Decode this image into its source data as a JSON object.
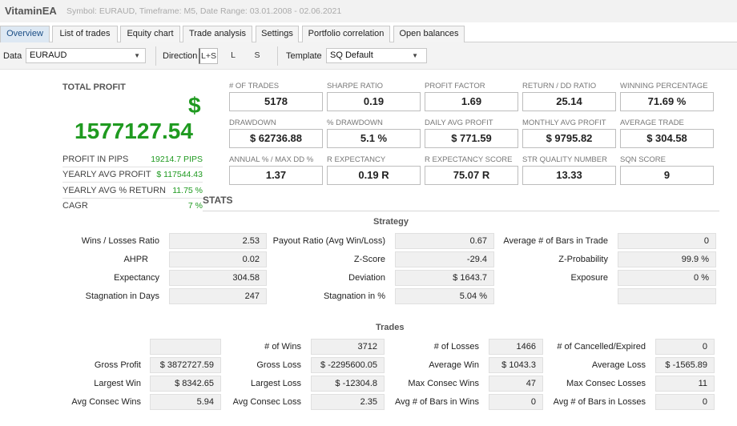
{
  "app": {
    "title": "VitaminEA",
    "info": "Symbol: EURAUD, Timeframe: M5, Date Range: 03.01.2008 - 02.06.2021"
  },
  "tabs": [
    "Overview",
    "List of trades",
    "Equity chart",
    "Trade analysis",
    "Settings",
    "Portfolio correlation",
    "Open balances"
  ],
  "toolbar": {
    "data_label": "Data",
    "data_value": "EURAUD",
    "direction_label": "Direction",
    "directions": [
      "L+S",
      "L",
      "S"
    ],
    "template_label": "Template",
    "template_value": "SQ Default"
  },
  "summary": {
    "total_label": "TOTAL PROFIT",
    "total_icon": "dollar-icon",
    "total_icon_glyph": "$",
    "total_value": "1577127.54",
    "accent_color": "#1f9a20",
    "rows": [
      {
        "label": "PROFIT IN PIPS",
        "value": "19214.7 PIPS"
      },
      {
        "label": "YEARLY AVG PROFIT",
        "value": "$ 117544.43"
      },
      {
        "label": "YEARLY AVG % RETURN",
        "value": "11.75 %"
      },
      {
        "label": "CAGR",
        "value": "7 %"
      }
    ]
  },
  "metrics": [
    {
      "label": "# OF TRADES",
      "value": "5178"
    },
    {
      "label": "SHARPE RATIO",
      "value": "0.19"
    },
    {
      "label": "PROFIT FACTOR",
      "value": "1.69"
    },
    {
      "label": "RETURN / DD RATIO",
      "value": "25.14"
    },
    {
      "label": "WINNING PERCENTAGE",
      "value": "71.69 %"
    },
    {
      "label": "DRAWDOWN",
      "value": "$ 62736.88"
    },
    {
      "label": "% DRAWDOWN",
      "value": "5.1 %"
    },
    {
      "label": "DAILY AVG PROFIT",
      "value": "$ 771.59"
    },
    {
      "label": "MONTHLY AVG PROFIT",
      "value": "$ 9795.82"
    },
    {
      "label": "AVERAGE TRADE",
      "value": "$ 304.58"
    },
    {
      "label": "ANNUAL % / MAX DD %",
      "value": "1.37"
    },
    {
      "label": "R EXPECTANCY",
      "value": "0.19 R"
    },
    {
      "label": "R EXPECTANCY SCORE",
      "value": "75.07 R"
    },
    {
      "label": "STR QUALITY NUMBER",
      "value": "13.33"
    },
    {
      "label": "SQN SCORE",
      "value": "9"
    }
  ],
  "stats": {
    "title": "STATS",
    "strategy": {
      "title": "Strategy",
      "rows": [
        [
          {
            "label": "Wins / Losses Ratio",
            "value": "2.53"
          },
          {
            "label": "Payout Ratio (Avg Win/Loss)",
            "value": "0.67"
          },
          {
            "label": "Average # of Bars in Trade",
            "value": "0"
          }
        ],
        [
          {
            "label": "AHPR",
            "value": "0.02"
          },
          {
            "label": "Z-Score",
            "value": "-29.4"
          },
          {
            "label": "Z-Probability",
            "value": "99.9 %"
          }
        ],
        [
          {
            "label": "Expectancy",
            "value": "304.58"
          },
          {
            "label": "Deviation",
            "value": "$ 1643.7"
          },
          {
            "label": "Exposure",
            "value": "0 %"
          }
        ],
        [
          {
            "label": "Stagnation in Days",
            "value": "247"
          },
          {
            "label": "Stagnation in %",
            "value": "5.04 %"
          },
          {
            "label": "",
            "value": ""
          }
        ]
      ]
    },
    "trades": {
      "title": "Trades",
      "rows": [
        [
          {
            "label": "",
            "value": ""
          },
          {
            "label": "# of Wins",
            "value": "3712"
          },
          {
            "label": "# of Losses",
            "value": "1466"
          },
          {
            "label": "# of Cancelled/Expired",
            "value": "0"
          }
        ],
        [
          {
            "label": "Gross Profit",
            "value": "$ 3872727.59"
          },
          {
            "label": "Gross Loss",
            "value": "$ -2295600.05"
          },
          {
            "label": "Average Win",
            "value": "$ 1043.3"
          },
          {
            "label": "Average Loss",
            "value": "$ -1565.89"
          }
        ],
        [
          {
            "label": "Largest Win",
            "value": "$ 8342.65"
          },
          {
            "label": "Largest Loss",
            "value": "$ -12304.8"
          },
          {
            "label": "Max Consec Wins",
            "value": "47"
          },
          {
            "label": "Max Consec Losses",
            "value": "11"
          }
        ],
        [
          {
            "label": "Avg Consec Wins",
            "value": "5.94"
          },
          {
            "label": "Avg Consec Loss",
            "value": "2.35"
          },
          {
            "label": "Avg # of Bars in Wins",
            "value": "0"
          },
          {
            "label": "Avg # of Bars in Losses",
            "value": "0"
          }
        ]
      ]
    }
  }
}
